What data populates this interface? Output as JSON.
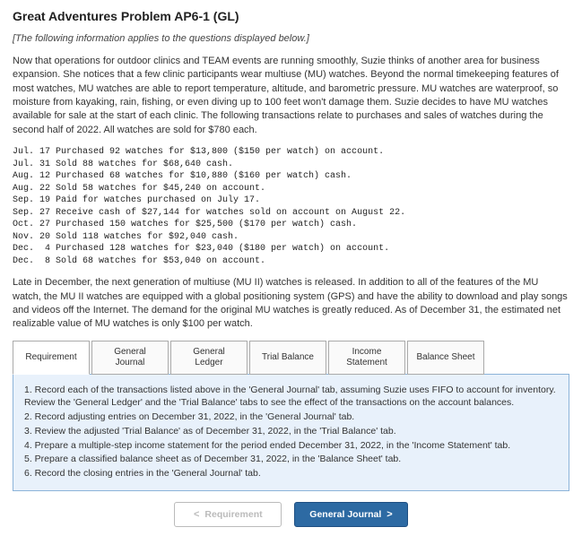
{
  "header": {
    "title": "Great Adventures Problem AP6-1 (GL)",
    "subtitle": "[The following information applies to the questions displayed below.]"
  },
  "paragraphs": {
    "p1": "Now that operations for outdoor clinics and TEAM events are running smoothly, Suzie thinks of another area for business expansion. She notices that a few clinic participants wear multiuse (MU) watches. Beyond the normal timekeeping features of most watches, MU watches are able to report temperature, altitude, and barometric pressure. MU watches are waterproof, so moisture from kayaking, rain, fishing, or even diving up to 100 feet won't damage them. Suzie decides to have MU watches available for sale at the start of each clinic. The following transactions relate to purchases and sales of watches during the second half of 2022. All watches are sold for $780 each.",
    "p2": "Late in December, the next generation of multiuse (MU II) watches is released. In addition to all of the features of the MU watch, the MU II watches are equipped with a global positioning system (GPS) and have the ability to download and play songs and videos off the Internet. The demand for the original MU watches is greatly reduced. As of December 31, the estimated net realizable value of MU watches is only $100 per watch."
  },
  "transactions": "Jul. 17 Purchased 92 watches for $13,800 ($150 per watch) on account.\nJul. 31 Sold 88 watches for $68,640 cash.\nAug. 12 Purchased 68 watches for $10,880 ($160 per watch) cash.\nAug. 22 Sold 58 watches for $45,240 on account.\nSep. 19 Paid for watches purchased on July 17.\nSep. 27 Receive cash of $27,144 for watches sold on account on August 22.\nOct. 27 Purchased 150 watches for $25,500 ($170 per watch) cash.\nNov. 20 Sold 118 watches for $92,040 cash.\nDec.  4 Purchased 128 watches for $23,040 ($180 per watch) on account.\nDec.  8 Sold 68 watches for $53,040 on account.",
  "tabs": [
    {
      "label": "Requirement"
    },
    {
      "label": "General\nJournal"
    },
    {
      "label": "General\nLedger"
    },
    {
      "label": "Trial Balance"
    },
    {
      "label": "Income\nStatement"
    },
    {
      "label": "Balance Sheet"
    }
  ],
  "requirements": {
    "r1": "1. Record each of the transactions listed above in the 'General Journal' tab, assuming Suzie uses FIFO to account for inventory. Review the 'General Ledger' and the 'Trial Balance' tabs to see the effect of the transactions on the account balances.",
    "r2": "2. Record adjusting entries on December 31, 2022, in the 'General Journal' tab.",
    "r3": "3. Review the adjusted 'Trial Balance' as of December 31, 2022, in the 'Trial Balance' tab.",
    "r4": "4. Prepare a multiple-step income statement for the period ended December 31, 2022, in the 'Income Statement' tab.",
    "r5": "5. Prepare a classified balance sheet as of December 31, 2022, in the 'Balance Sheet' tab.",
    "r6": "6. Record the closing entries in the 'General Journal' tab."
  },
  "nav": {
    "prev_label": "Requirement",
    "next_label": "General Journal",
    "prev_chevron": "<",
    "next_chevron": ">"
  }
}
